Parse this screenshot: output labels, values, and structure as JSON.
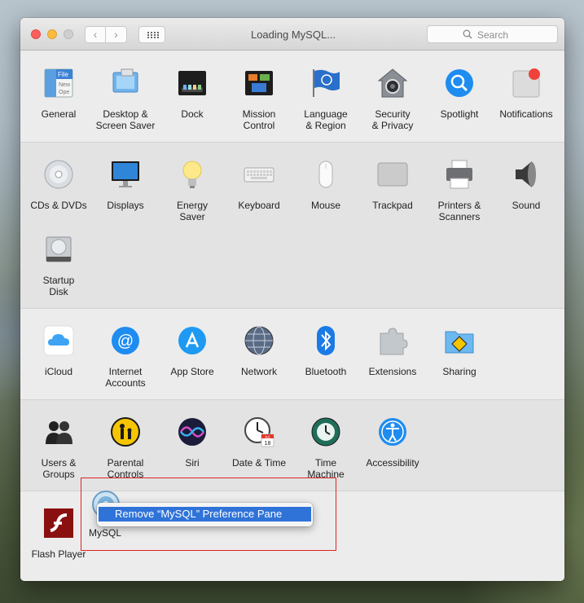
{
  "window": {
    "title": "Loading MySQL...",
    "search_placeholder": "Search"
  },
  "toolbar": {
    "back_glyph": "‹",
    "forward_glyph": "›"
  },
  "sections": [
    {
      "panes": [
        {
          "label": "General",
          "icon": "general-icon"
        },
        {
          "label": "Desktop &\nScreen Saver",
          "icon": "desktop-icon"
        },
        {
          "label": "Dock",
          "icon": "dock-icon"
        },
        {
          "label": "Mission\nControl",
          "icon": "mission-control-icon"
        },
        {
          "label": "Language\n& Region",
          "icon": "language-icon"
        },
        {
          "label": "Security\n& Privacy",
          "icon": "security-icon"
        },
        {
          "label": "Spotlight",
          "icon": "spotlight-icon"
        },
        {
          "label": "Notifications",
          "icon": "notifications-icon"
        }
      ]
    },
    {
      "panes": [
        {
          "label": "CDs & DVDs",
          "icon": "cd-icon"
        },
        {
          "label": "Displays",
          "icon": "displays-icon"
        },
        {
          "label": "Energy\nSaver",
          "icon": "energy-icon"
        },
        {
          "label": "Keyboard",
          "icon": "keyboard-icon"
        },
        {
          "label": "Mouse",
          "icon": "mouse-icon"
        },
        {
          "label": "Trackpad",
          "icon": "trackpad-icon"
        },
        {
          "label": "Printers &\nScanners",
          "icon": "printer-icon"
        },
        {
          "label": "Sound",
          "icon": "sound-icon"
        },
        {
          "label": "Startup\nDisk",
          "icon": "disk-icon"
        }
      ]
    },
    {
      "panes": [
        {
          "label": "iCloud",
          "icon": "icloud-icon"
        },
        {
          "label": "Internet\nAccounts",
          "icon": "internet-accounts-icon"
        },
        {
          "label": "App Store",
          "icon": "app-store-icon"
        },
        {
          "label": "Network",
          "icon": "network-icon"
        },
        {
          "label": "Bluetooth",
          "icon": "bluetooth-icon"
        },
        {
          "label": "Extensions",
          "icon": "extensions-icon"
        },
        {
          "label": "Sharing",
          "icon": "sharing-icon"
        }
      ]
    },
    {
      "panes": [
        {
          "label": "Users &\nGroups",
          "icon": "users-icon"
        },
        {
          "label": "Parental\nControls",
          "icon": "parental-icon"
        },
        {
          "label": "Siri",
          "icon": "siri-icon"
        },
        {
          "label": "Date & Time",
          "icon": "date-time-icon"
        },
        {
          "label": "Time\nMachine",
          "icon": "time-machine-icon"
        },
        {
          "label": "Accessibility",
          "icon": "accessibility-icon"
        }
      ]
    },
    {
      "panes": [
        {
          "label": "Flash Player",
          "icon": "flash-icon"
        },
        {
          "label": "MySQL",
          "icon": "mysql-icon"
        }
      ]
    }
  ],
  "general_icon_text": [
    "File",
    "New",
    "Ope"
  ],
  "calendar_icon_text": {
    "month": "JUL",
    "day": "18"
  },
  "context_menu": {
    "item": "Remove “MySQL” Preference Pane"
  },
  "colors": {
    "highlight_border": "#e02323",
    "menu_selection": "#2f73d9"
  }
}
